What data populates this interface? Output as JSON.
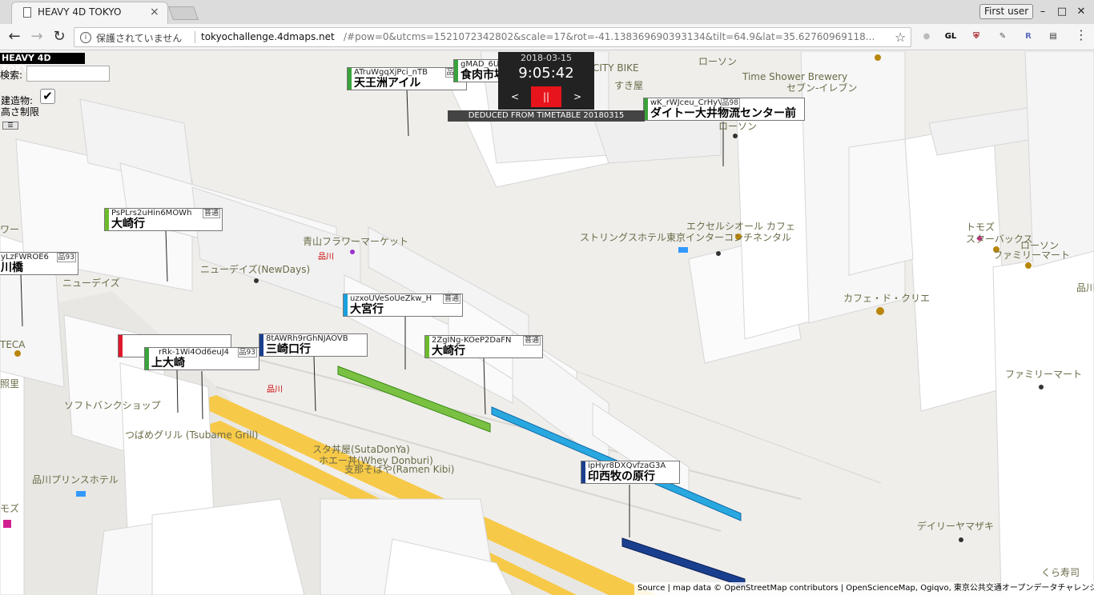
{
  "browser": {
    "tab_title": "HEAVY 4D TOKYO",
    "tab_close": "×",
    "profile": "First user",
    "win_min": "–",
    "win_max": "□",
    "win_close": "✕",
    "back": "←",
    "forward": "→",
    "reload": "↻",
    "info_icon": "i",
    "insecure": "保護されていません",
    "url_domain": "tokyochallenge.4dmaps.net",
    "url_rest": "/#pow=0&utcms=1521072342802&scale=17&rot=-41.138369690393134&tilt=64.9&lat=35.62760969118...",
    "star": "☆",
    "menu": "⋮",
    "extensions": [
      {
        "label": "GL",
        "color": "#a0191d"
      },
      {
        "label": "UD",
        "color": "#8b1a1a"
      },
      {
        "label": "✎",
        "color": "#555"
      },
      {
        "label": "R",
        "color": "#5c6bc0"
      },
      {
        "label": "▤",
        "color": "#333"
      }
    ]
  },
  "app": {
    "title": "HEAVY 4D TOKYO",
    "search_label": "検索:",
    "buildings_label_1": "建造物:",
    "buildings_label_2": "高さ制限",
    "buildings_checked": "✔",
    "menu_toggle": "☰"
  },
  "clock": {
    "date": "2018-03-15",
    "time": "9:05:42",
    "prev": "<",
    "pause": "||",
    "next": ">",
    "source": "DEDUCED FROM TIMETABLE 20180315"
  },
  "trains": [
    {
      "code": "ATruWgqXjPci_nTB",
      "dest": "天王洲アイル",
      "type": "品96",
      "color": "#3aa33a"
    },
    {
      "code": "gMAD_6UYJGC",
      "dest": "食肉市場前",
      "type": "",
      "color": "#3aa33a"
    },
    {
      "code": "wK_rWJceu_CrHyV",
      "dest": "ダイトー大井物流センター前",
      "type": "品98",
      "color": "#3aa33a"
    },
    {
      "code": "PsPLrs2uHin6MOWh",
      "dest": "大崎行",
      "type": "普通",
      "color": "#6cbb2c"
    },
    {
      "code": "yLzFWROE6",
      "dest": "川橋",
      "type": "品93",
      "color": "#3aa33a"
    },
    {
      "code": "uzxoUVeSoUeZkw_H",
      "dest": "大宮行",
      "type": "普通",
      "color": "#1aa0e0"
    },
    {
      "code": "rRk-1Wi4Od6euJ4",
      "dest": "上大崎",
      "type": "品93",
      "color": "#3aa33a"
    },
    {
      "code": "8tAWRh9rGhNJAOVB",
      "dest": "三崎口行",
      "type": "",
      "color": "#1b3f8f"
    },
    {
      "code": "2ZgINg-KOeP2DaFN",
      "dest": "大崎行",
      "type": "普通",
      "color": "#6cbb2c"
    },
    {
      "code": "ipHyr8DXQvfzaG3A",
      "dest": "印西牧の原行",
      "type": "",
      "color": "#1b3f8f"
    }
  ],
  "places": [
    "CITY BIKE",
    "ローソン",
    "Time Shower Brewery",
    "セブン-イレブン",
    "すき屋",
    "ローソン",
    "青山フラワーマーケット",
    "品川",
    "ニューデイズ(NewDays)",
    "ニューデイズ",
    "エクセルシオール カフェ",
    "ストリングスホテル東京インターコンチネンタル",
    "トモズ",
    "スターバックス",
    "ローソン",
    "ファミリーマート",
    "カフェ・ド・クリエ",
    "ファミリーマート",
    "品川",
    "ソフトバンクショップ",
    "つばめグリル (Tsubame Grill)",
    "スタ丼屋(SutaDonYa)",
    "ホエー丼(Whey Donburi)",
    "支那そばや(Ramen Kibi)",
    "品川プリンスホテル",
    "デイリーヤマザキ",
    "くら寿司",
    "モズ",
    "ワー",
    "照里",
    "TECA",
    "品川"
  ],
  "attribution": "Source | map data © OpenStreetMap contributors | OpenScienceMap, Ogiqvo, 東京公共交通オープンデータチャレンジ"
}
